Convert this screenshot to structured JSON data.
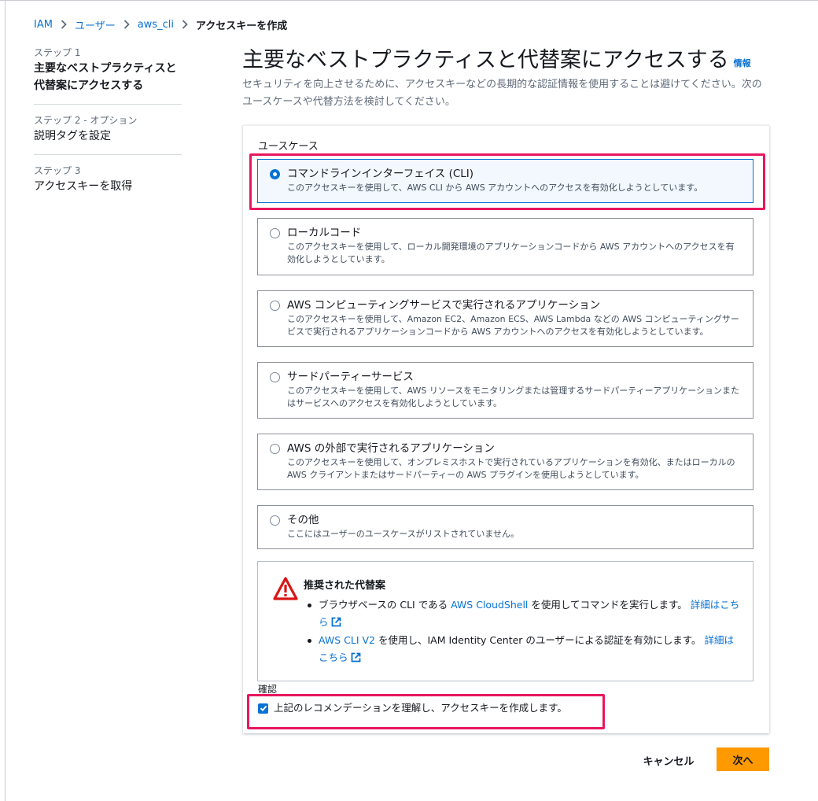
{
  "colors": {
    "accent": "#0972d3",
    "highlight": "#e8175d",
    "primary_button": "#ff9900",
    "warning": "#d91515"
  },
  "breadcrumb": [
    "IAM",
    "ユーザー",
    "aws_cli",
    "アクセスキーを作成"
  ],
  "steps": [
    {
      "step": "ステップ 1",
      "title": "主要なベストプラクティスと代替案にアクセスする"
    },
    {
      "step": "ステップ 2 - オプション",
      "title": "説明タグを設定"
    },
    {
      "step": "ステップ 3",
      "title": "アクセスキーを取得"
    }
  ],
  "header": {
    "title": "主要なベストプラクティスと代替案にアクセスする",
    "info": "情報",
    "description": "セキュリティを向上させるために、アクセスキーなどの長期的な認証情報を使用することは避けてください。次のユースケースや代替方法を検討してください。"
  },
  "use_case": {
    "label": "ユースケース",
    "options": [
      {
        "title": "コマンドラインインターフェイス (CLI)",
        "description": "このアクセスキーを使用して、AWS CLI から AWS アカウントへのアクセスを有効化しようとしています。",
        "selected": true
      },
      {
        "title": "ローカルコード",
        "description": "このアクセスキーを使用して、ローカル開発環境のアプリケーションコードから AWS アカウントへのアクセスを有効化しようとしています。",
        "selected": false
      },
      {
        "title": "AWS コンピューティングサービスで実行されるアプリケーション",
        "description": "このアクセスキーを使用して、Amazon EC2、Amazon ECS、AWS Lambda などの AWS コンピューティングサービスで実行されるアプリケーションコードから AWS アカウントへのアクセスを有効化しようとしています。",
        "selected": false
      },
      {
        "title": "サードパーティーサービス",
        "description": "このアクセスキーを使用して、AWS リソースをモニタリングまたは管理するサードパーティーアプリケーションまたはサービスへのアクセスを有効化しようとしています。",
        "selected": false
      },
      {
        "title": "AWS の外部で実行されるアプリケーション",
        "description": "このアクセスキーを使用して、オンプレミスホストで実行されているアプリケーションを有効化、またはローカルの AWS クライアントまたはサードパーティーの AWS プラグインを使用しようとしています。",
        "selected": false
      },
      {
        "title": "その他",
        "description": "ここにはユーザーのユースケースがリストされていません。",
        "selected": false
      }
    ]
  },
  "alert": {
    "title": "推奨された代替案",
    "items": [
      {
        "prefix": "ブラウザベースの CLI である ",
        "link": "AWS CloudShell",
        "middle": " を使用してコマンドを実行します。",
        "more": "詳細はこちら",
        "icon": "external-link-icon"
      },
      {
        "prefix": "",
        "link": "AWS CLI V2",
        "middle": " を使用し、IAM Identity Center のユーザーによる認証を有効にします。",
        "more": "詳細はこちら",
        "icon": "external-link-icon"
      }
    ]
  },
  "confirm": {
    "label": "確認",
    "checkbox_label": "上記のレコメンデーションを理解し、アクセスキーを作成します。",
    "checked": true
  },
  "buttons": {
    "cancel": "キャンセル",
    "next": "次へ"
  }
}
